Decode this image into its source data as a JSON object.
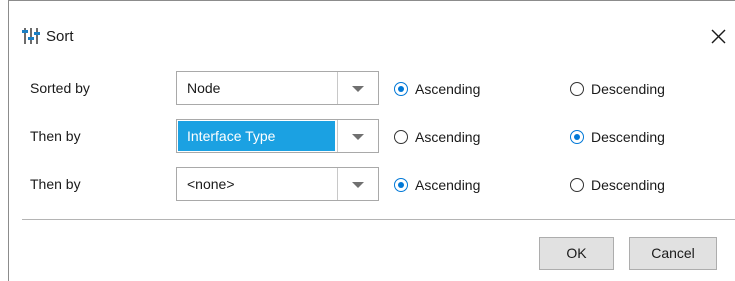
{
  "dialog": {
    "title": "Sort",
    "title_icon": "sort-sliders-icon",
    "close_icon": "close-icon"
  },
  "rows": [
    {
      "label": "Sorted by",
      "selected_value": "Node",
      "highlighted": false,
      "ascending_label": "Ascending",
      "descending_label": "Descending",
      "order": "ascending"
    },
    {
      "label": "Then by",
      "selected_value": "Interface Type",
      "highlighted": true,
      "ascending_label": "Ascending",
      "descending_label": "Descending",
      "order": "descending"
    },
    {
      "label": "Then by",
      "selected_value": "<none>",
      "highlighted": false,
      "ascending_label": "Ascending",
      "descending_label": "Descending",
      "order": "ascending"
    }
  ],
  "buttons": {
    "ok_label": "OK",
    "cancel_label": "Cancel"
  },
  "colors": {
    "accent": "#0078d7",
    "selection_highlight": "#1ba1e2",
    "button_face": "#e1e1e1"
  }
}
